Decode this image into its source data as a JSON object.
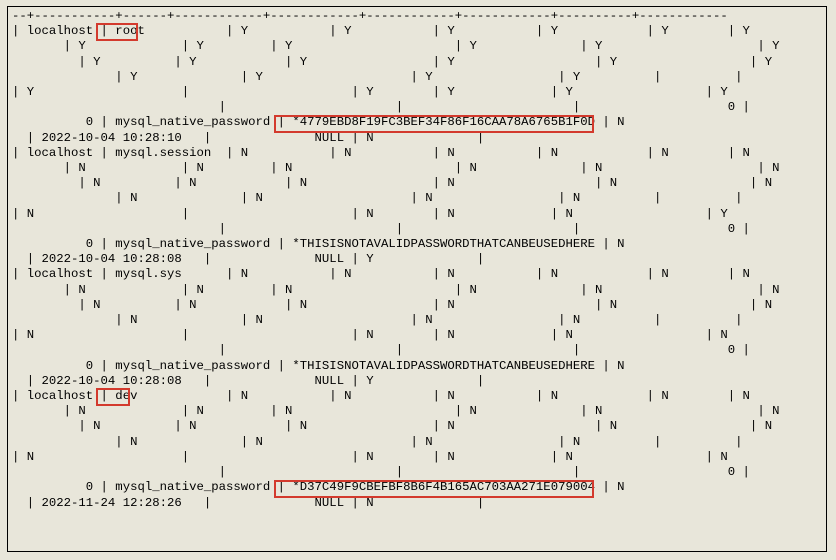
{
  "highlights": {
    "root": "root",
    "dev": "dev",
    "hash1": "*4779EBD8F19FC3BEF34F86F16CAA78A6765B1F0D",
    "hash2": "*D37C49F9CBEFBF8B6F4B165AC703AA271E079004"
  },
  "rows": [
    {
      "host": "localhost",
      "user": "root",
      "plugin": "mysql_native_password",
      "auth_string": "*4779EBD8F19FC3BEF34F86F16CAA78A6765B1F0D",
      "password_expired": "N",
      "password_last_changed": "2022-10-04 10:28:10",
      "max_user_connections": 0
    },
    {
      "host": "localhost",
      "user": "mysql.session",
      "plugin": "mysql_native_password",
      "auth_string": "*THISISNOTAVALIDPASSWORDTHATCANBEUSEDHERE",
      "password_expired": "N",
      "password_last_changed": "2022-10-04 10:28:08",
      "max_user_connections": 0
    },
    {
      "host": "localhost",
      "user": "mysql.sys",
      "plugin": "mysql_native_password",
      "auth_string": "*THISISNOTAVALIDPASSWORDTHATCANBEUSEDHERE",
      "password_expired": "N",
      "password_last_changed": "2022-10-04 10:28:08",
      "max_user_connections": 0
    },
    {
      "host": "localhost",
      "user": "dev",
      "plugin": "mysql_native_password",
      "auth_string": "*D37C49F9CBEFBF8B6F4B165AC703AA271E079004",
      "password_expired": "N",
      "password_last_changed": "2022-11-24 12:28:26",
      "max_user_connections": 0
    }
  ],
  "lines": [
    "--+-----------+------+------------+------------+------------+------------+----------+------------",
    "| localhost | root           | Y           | Y           | Y           | Y            | Y        | Y          | Y",
    "       | Y             | Y         | Y                      | Y              | Y                     | Y                | Y  ",
    "         | Y          | Y            | Y                 | Y                   | Y                  | Y               | Y  ",
    "              | Y              | Y                    | Y                 | Y          |          |            |        ",
    "| Y                    |                      | Y        | Y             | Y                  | Y                     |  ",
    "                            |                       |                       |                    0 |               0 |   ",
    "          0 | mysql_native_password | *4779EBD8F19FC3BEF34F86F16CAA78A6765B1F0D | N               ",
    "  | 2022-10-04 10:28:10   |              NULL | N              |",
    "| localhost | mysql.session  | N           | N           | N           | N            | N        | N          | N",
    "       | N             | N         | N                      | N              | N                     | N                | N  ",
    "         | N          | N            | N                 | N                   | N                  | N               | N  ",
    "              | N              | N                    | N                 | N          |          |            |        ",
    "| N                    |                      | N        | N             | N                  | Y                     |  ",
    "                            |                       |                       |                    0 |               0 |   ",
    "          0 | mysql_native_password | *THISISNOTAVALIDPASSWORDTHATCANBEUSEDHERE | N               ",
    "  | 2022-10-04 10:28:08   |              NULL | Y              |",
    "| localhost | mysql.sys      | N           | N           | N           | N            | N        | N          | N",
    "       | N             | N         | N                      | N              | N                     | N                | N  ",
    "         | N          | N            | N                 | N                   | N                  | N               | N  ",
    "              | N              | N                    | N                 | N          |          |            |        ",
    "| N                    |                      | N        | N             | N                  | N                     |  ",
    "                            |                       |                       |                    0 |               0 |   ",
    "          0 | mysql_native_password | *THISISNOTAVALIDPASSWORDTHATCANBEUSEDHERE | N               ",
    "  | 2022-10-04 10:28:08   |              NULL | Y              |",
    "| localhost | dev            | N           | N           | N           | N            | N        | N          | N",
    "       | N             | N         | N                      | N              | N                     | N                | N  ",
    "         | N          | N            | N                 | N                   | N                  | N               | N  ",
    "              | N              | N                    | N                 | N          |          |            |        ",
    "| N                    |                      | N        | N             | N                  | N                     |  ",
    "                            |                       |                       |                    0 |               0 |   ",
    "          0 | mysql_native_password | *D37C49F9CBEFBF8B6F4B165AC703AA271E079004 | N               ",
    "  | 2022-11-24 12:28:26   |              NULL | N              |"
  ]
}
